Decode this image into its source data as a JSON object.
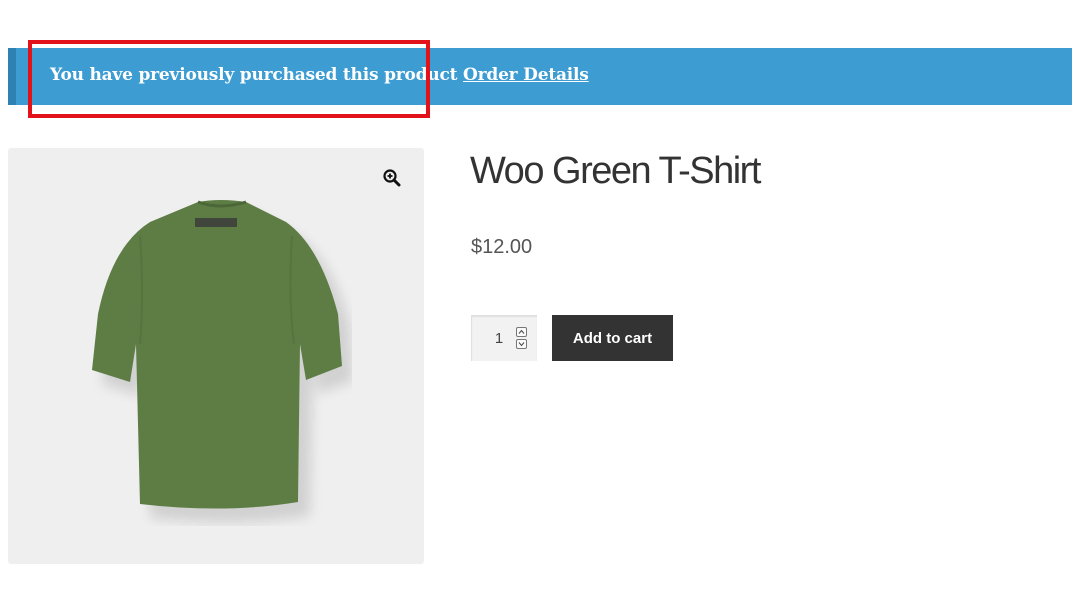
{
  "notice": {
    "message": "You have previously purchased this product",
    "link_label": "Order Details",
    "background": "#3d9cd2"
  },
  "highlight": {
    "color": "#e3121a"
  },
  "product": {
    "title": "Woo Green T-Shirt",
    "price": "$12.00",
    "quantity": "1",
    "add_to_cart_label": "Add to cart",
    "image_icon": "zoom-in-icon",
    "shirt_color": "#5e7d45"
  }
}
